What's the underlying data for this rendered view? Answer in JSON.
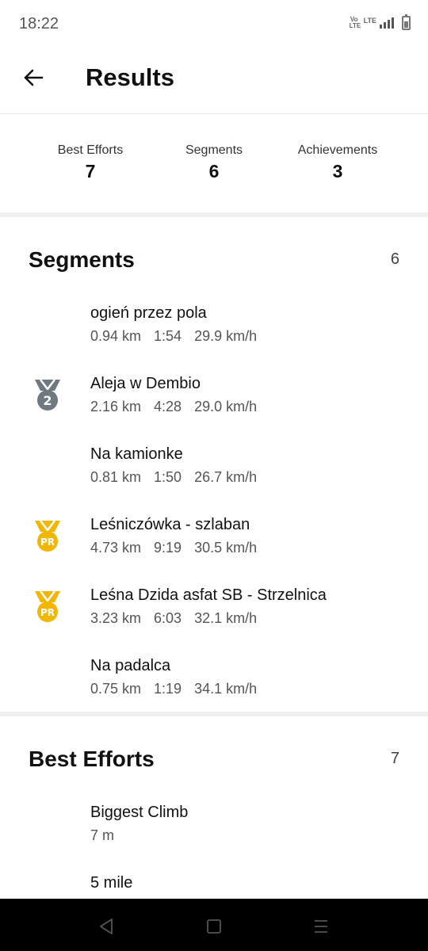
{
  "status": {
    "time": "18:22",
    "volte": "Vo LTE",
    "network": "LTE"
  },
  "header": {
    "title": "Results"
  },
  "summary": [
    {
      "label": "Best Efforts",
      "value": "7"
    },
    {
      "label": "Segments",
      "value": "6"
    },
    {
      "label": "Achievements",
      "value": "3"
    }
  ],
  "segments": {
    "title": "Segments",
    "count": "6",
    "items": [
      {
        "name": "ogień przez pola",
        "distance": "0.94 km",
        "time": "1:54",
        "speed": "29.9 km/h",
        "badge": ""
      },
      {
        "name": "Aleja w Dembio",
        "distance": "2.16 km",
        "time": "4:28",
        "speed": "29.0 km/h",
        "badge": "2",
        "badge_color": "#6e7a80"
      },
      {
        "name": "Na kamionke",
        "distance": "0.81 km",
        "time": "1:50",
        "speed": "26.7 km/h",
        "badge": ""
      },
      {
        "name": "Leśniczówka - szlaban",
        "distance": "4.73 km",
        "time": "9:19",
        "speed": "30.5 km/h",
        "badge": "PR",
        "badge_color": "#f2b705"
      },
      {
        "name": "Leśna Dzida asfat SB - Strzelnica",
        "distance": "3.23 km",
        "time": "6:03",
        "speed": "32.1 km/h",
        "badge": "PR",
        "badge_color": "#f2b705"
      },
      {
        "name": "Na padalca",
        "distance": "0.75 km",
        "time": "1:19",
        "speed": "34.1 km/h",
        "badge": ""
      }
    ]
  },
  "best_efforts": {
    "title": "Best Efforts",
    "count": "7",
    "items": [
      {
        "name": "Biggest Climb",
        "value": "7 m"
      },
      {
        "name": "5 mile",
        "value": ""
      }
    ]
  }
}
